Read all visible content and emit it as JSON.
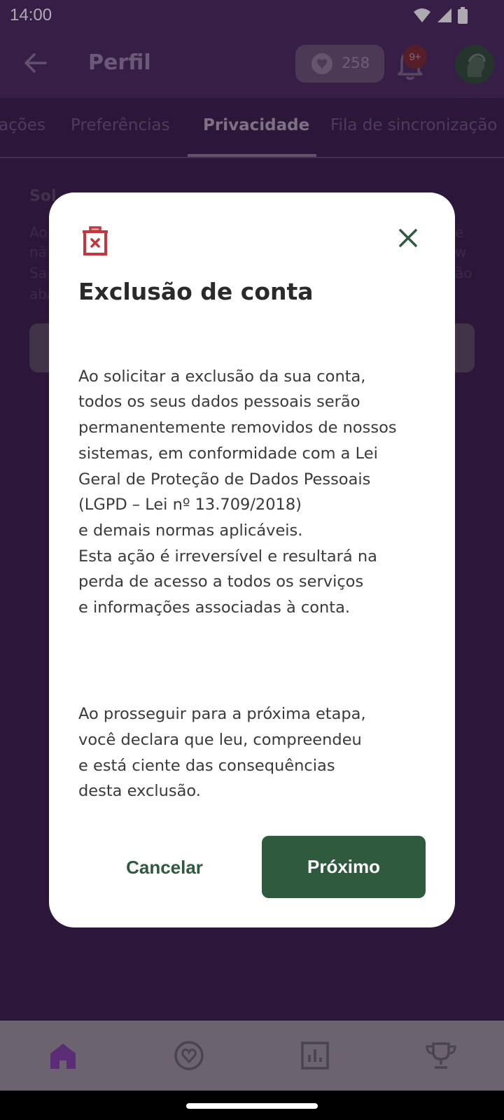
{
  "status_bar": {
    "time": "14:00",
    "icons": [
      "wifi-icon",
      "signal-icon",
      "battery-icon"
    ]
  },
  "app_bar": {
    "title": "Perfil",
    "points": "258",
    "notifications_badge": "9+",
    "icons": [
      "back-arrow-icon",
      "heart-badge-icon",
      "bell-icon",
      "avatar"
    ]
  },
  "tabs": [
    {
      "label": "ações"
    },
    {
      "label": "Preferências"
    },
    {
      "label": "Privacidade",
      "active": true
    },
    {
      "label": "Fila de sincronização"
    }
  ],
  "background_content": {
    "heading": "Sol",
    "lines": [
      "Ao",
      "nã",
      "Sa",
      "aba"
    ],
    "right_fragments": [
      "e",
      "w",
      "ão"
    ]
  },
  "dialog": {
    "icon": "trash-x-icon",
    "close_icon": "close-icon",
    "title": "Exclusão de conta",
    "paragraph1": "Ao solicitar a exclusão da sua conta,\ntodos os seus dados pessoais serão\npermanentemente removidos de nossos\nsistemas, em conformidade com a Lei\nGeral de Proteção de Dados Pessoais\n(LGPD – Lei nº 13.709/2018)\ne demais normas aplicáveis.\nEsta ação é irreversível e resultará na\nperda de acesso a todos os serviços\ne informações associadas à conta.",
    "paragraph2": "Ao prosseguir para a próxima etapa,\nvocê declara que leu, compreendeu\ne está ciente das consequências\ndesta exclusão.",
    "cancel_label": "Cancelar",
    "next_label": "Próximo"
  },
  "bottom_nav": {
    "items": [
      "home-icon",
      "heart-circle-icon",
      "chart-icon",
      "trophy-icon"
    ],
    "active_index": 0
  },
  "colors": {
    "primary_green": "#2f5a3e",
    "delete_red": "#c0393f",
    "app_purple": "#4a2a5c"
  }
}
